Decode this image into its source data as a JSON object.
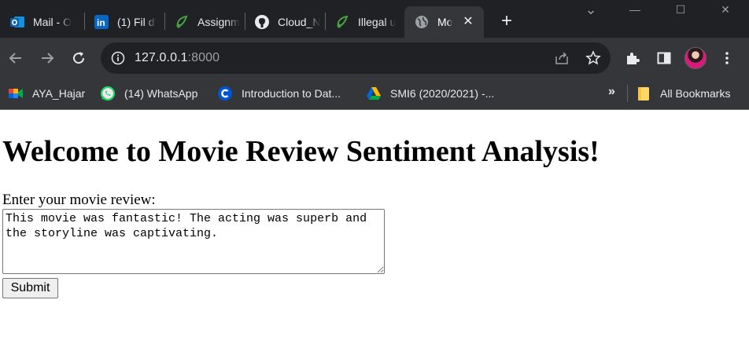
{
  "browser": {
    "tabs": [
      {
        "title": "Mail - O",
        "icon": "outlook-icon"
      },
      {
        "title": "(1) Fil d'",
        "icon": "linkedin-icon"
      },
      {
        "title": "Assignm",
        "icon": "overleaf-icon"
      },
      {
        "title": "Cloud_N",
        "icon": "github-icon"
      },
      {
        "title": "Illegal u",
        "icon": "overleaf-icon"
      },
      {
        "title": "Mo",
        "icon": "globe-icon",
        "active": true
      }
    ],
    "new_tab_label": "+",
    "window_controls": {
      "minimize": "—",
      "restore": "☐",
      "close": "✕"
    },
    "tab_search": "⌄",
    "url": {
      "host": "127.0.0.1",
      "port": ":8000"
    },
    "bookmarks": [
      {
        "label": "AYA_Hajar",
        "icon": "google-meet-icon"
      },
      {
        "label": "(14) WhatsApp",
        "icon": "whatsapp-icon"
      },
      {
        "label": "Introduction to Dat...",
        "icon": "coursera-icon"
      },
      {
        "label": "SMI6 (2020/2021) -...",
        "icon": "google-drive-icon"
      }
    ],
    "bookmarks_overflow": "»",
    "all_bookmarks_label": "All Bookmarks"
  },
  "page": {
    "heading": "Welcome to Movie Review Sentiment Analysis!",
    "review_label": "Enter your movie review:",
    "review_value": "This movie was fantastic! The acting was superb and the storyline was captivating.",
    "submit_label": "Submit"
  },
  "colors": {
    "tabstrip_bg": "#202124",
    "toolbar_bg": "#35363a",
    "omnibox_bg": "#202124",
    "text_light": "#e8eaed"
  }
}
